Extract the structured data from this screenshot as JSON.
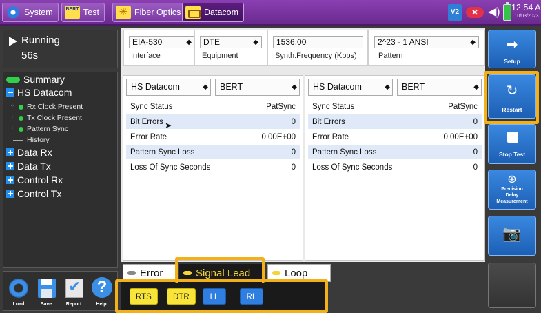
{
  "topbar": {
    "tabs": [
      {
        "label": "System",
        "icon": "gear-icon"
      },
      {
        "label": "Test",
        "icon": "bert-icon",
        "icon_text": "BERT"
      },
      {
        "label": "Fiber Optics",
        "icon": "fiber-icon"
      },
      {
        "label": "Datacom",
        "icon": "datacom-icon"
      }
    ],
    "status": {
      "v2_label": "V2",
      "time": "12:54 AM",
      "date": "10/03/2023"
    }
  },
  "run": {
    "state": "Running",
    "elapsed": "56s"
  },
  "tree": {
    "summary": "Summary",
    "hs_datacom": "HS Datacom",
    "rx_clock": "Rx Clock Present",
    "tx_clock": "Tx Clock Present",
    "pattern_sync": "Pattern Sync",
    "history": "History",
    "data_rx": "Data Rx",
    "data_tx": "Data Tx",
    "control_rx": "Control Rx",
    "control_tx": "Control Tx"
  },
  "bottom_tools": {
    "load": "Load",
    "save": "Save",
    "report": "Report",
    "help": "Help"
  },
  "config": {
    "interface": {
      "value": "EIA-530",
      "caption": "Interface"
    },
    "equipment": {
      "value": "DTE",
      "caption": "Equipment"
    },
    "frequency": {
      "value": "1536.00",
      "caption": "Synth.Frequency (Kbps)"
    },
    "pattern": {
      "value": "2^23 - 1 ANSI",
      "caption": "Pattern"
    }
  },
  "panels": [
    {
      "select1": "HS Datacom",
      "select2": "BERT",
      "rows": [
        {
          "label": "Sync Status",
          "value": "PatSync"
        },
        {
          "label": "Bit Errors",
          "value": "0"
        },
        {
          "label": "Error Rate",
          "value": "0.00E+00"
        },
        {
          "label": "Pattern Sync Loss",
          "value": "0"
        },
        {
          "label": "Loss Of Sync Seconds",
          "value": "0"
        }
      ]
    },
    {
      "select1": "HS Datacom",
      "select2": "BERT",
      "rows": [
        {
          "label": "Sync Status",
          "value": "PatSync"
        },
        {
          "label": "Bit Errors",
          "value": "0"
        },
        {
          "label": "Error Rate",
          "value": "0.00E+00"
        },
        {
          "label": "Pattern Sync Loss",
          "value": "0"
        },
        {
          "label": "Loss Of Sync Seconds",
          "value": "0"
        }
      ]
    }
  ],
  "bottom_tabs": {
    "error": "Error",
    "signal_lead": "Signal Lead",
    "loop": "Loop"
  },
  "leads": {
    "rts": "RTS",
    "dtr": "DTR",
    "ll": "LL",
    "rl": "RL"
  },
  "side": {
    "setup": "Setup",
    "restart": "Restart",
    "stop_test": "Stop Test",
    "precision_delay": [
      "Precision",
      "Delay",
      "Measurement"
    ]
  },
  "colors": {
    "accent_purple": "#7b3aa3",
    "highlight": "#f2b01a",
    "active_green": "#2fd04a",
    "button_blue": "#2f7fe0",
    "lead_yellow": "#f9e53a"
  }
}
